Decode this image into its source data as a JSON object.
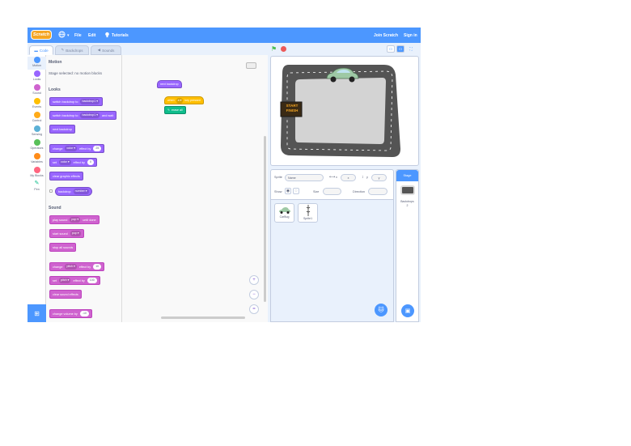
{
  "menubar": {
    "logo": "Scratch",
    "globe_caret": "▾",
    "file": "File",
    "edit": "Edit",
    "tutorials": "Tutorials",
    "join": "Join Scratch",
    "signin": "Sign in"
  },
  "tabs": {
    "code": "Code",
    "backdrops": "Backdrops",
    "sounds": "Sounds"
  },
  "categories": [
    {
      "label": "Motion",
      "color": "#4c97ff"
    },
    {
      "label": "Looks",
      "color": "#9966ff"
    },
    {
      "label": "Sound",
      "color": "#cf63cf"
    },
    {
      "label": "Events",
      "color": "#ffbf00"
    },
    {
      "label": "Control",
      "color": "#ffab19"
    },
    {
      "label": "Sensing",
      "color": "#5cb1d6"
    },
    {
      "label": "Operators",
      "color": "#59c059"
    },
    {
      "label": "Variables",
      "color": "#ff8c1a"
    },
    {
      "label": "My Blocks",
      "color": "#ff6680"
    },
    {
      "label": "Pen",
      "color": "#0fbd8c"
    }
  ],
  "palette": {
    "motion_heading": "Motion",
    "motion_note": "Stage selected: no motion blocks",
    "looks_heading": "Looks",
    "switch_backdrop_to": "switch backdrop to",
    "switch_backdrop_and_wait_prefix": "switch backdrop to",
    "switch_backdrop_and_wait_suffix": "and wait",
    "backdrop_value": "backdrop1 ▾",
    "next_backdrop": "next backdrop",
    "change_effect": "change",
    "color_dd": "color ▾",
    "effect_by": "effect by",
    "change_effect_value": "25",
    "set_effect": "set",
    "set_effect_value": "0",
    "to": "to",
    "clear_graphic_effects": "clear graphic effects",
    "backdrop_reporter": "backdrop",
    "number_dd": "number ▾",
    "sound_heading": "Sound",
    "play_sound": "play sound",
    "pop_dd": "pop ▾",
    "until_done": "until done",
    "start_sound": "start sound",
    "stop_all_sounds": "stop all sounds",
    "change_pitch": "change",
    "pitch_dd": "pitch ▾",
    "pitch_effect_by": "effect by",
    "pitch_value": "10",
    "set_pitch": "set",
    "set_pitch_value": "100",
    "clear_sound_effects": "clear sound effects",
    "change_volume": "change volume by",
    "volume_value": "-10"
  },
  "scripts": {
    "next_backdrop": "next backdrop",
    "when_key": "when",
    "key_dd": "a ▾",
    "key_pressed": "key pressed",
    "pen_block": "erase all",
    "zoom_in": "+",
    "zoom_out": "−",
    "reset": "="
  },
  "stage_head": {
    "flag": "⚑"
  },
  "sprite_info": {
    "sprite_label": "Sprite",
    "sprite_name": "Name",
    "x_label": "x",
    "y_label": "y",
    "x_value": "x",
    "y_value": "y",
    "show_label": "Show",
    "size_label": "Size",
    "direction_label": "Direction"
  },
  "sprites": [
    {
      "name": "CarBug"
    },
    {
      "name": "Sprite1"
    }
  ],
  "stage_panel": {
    "title": "Stage",
    "backdrops_label": "Backdrops",
    "backdrops_count": "2"
  },
  "stage_sign": {
    "line1": "START",
    "line2": "FINISH"
  }
}
